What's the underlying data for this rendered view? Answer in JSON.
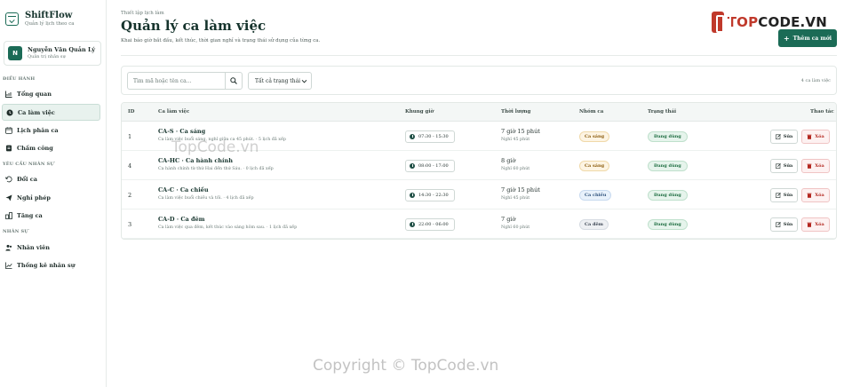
{
  "brand": {
    "name": "ShiftFlow",
    "subtitle": "Quản lý lịch theo ca"
  },
  "user": {
    "initial": "N",
    "name": "Nguyễn Văn Quản Lý",
    "role": "Quản trị nhân sự"
  },
  "sidebar": {
    "sections": [
      {
        "title": "Điều hành",
        "items": [
          {
            "label": "Tổng quan",
            "icon": "chart-icon"
          },
          {
            "label": "Ca làm việc",
            "icon": "clock-icon",
            "active": true
          },
          {
            "label": "Lịch phân ca",
            "icon": "calendar-icon"
          },
          {
            "label": "Chấm công",
            "icon": "fingerprint-icon"
          }
        ]
      },
      {
        "title": "Yêu cầu nhân sự",
        "items": [
          {
            "label": "Đổi ca",
            "icon": "swap-icon"
          },
          {
            "label": "Nghỉ phép",
            "icon": "send-icon"
          },
          {
            "label": "Tăng ca",
            "icon": "overtime-icon"
          }
        ]
      },
      {
        "title": "Nhân sự",
        "items": [
          {
            "label": "Nhân viên",
            "icon": "users-icon"
          },
          {
            "label": "Thống kê nhân sự",
            "icon": "stats-icon"
          }
        ]
      }
    ]
  },
  "header": {
    "breadcrumb": "Thiết lập lịch làm",
    "title": "Quản lý ca làm việc",
    "description": "Khai báo giờ bắt đầu, kết thúc, thời gian nghỉ và trạng thái sử dụng của từng ca.",
    "add_button": "Thêm ca mới"
  },
  "logo": {
    "prefix": "TOP",
    "suffix": "CODE.VN"
  },
  "filters": {
    "search_placeholder": "Tìm mã hoặc tên ca...",
    "status_selected": "Tất cả trạng thái",
    "count": "4 ca làm việc"
  },
  "table": {
    "columns": [
      "ID",
      "Ca làm việc",
      "Khung giờ",
      "Thời lượng",
      "Nhóm ca",
      "Trạng thái",
      "Thao tác"
    ],
    "rows": [
      {
        "id": "1",
        "name": "CA-S · Ca sáng",
        "desc": "Ca làm việc buổi sáng, nghỉ giữa ca 45 phút. · 5 lịch đã xếp",
        "time": "07:30 - 15:30",
        "duration": "7 giờ 15 phút",
        "break": "Nghỉ 45 phút",
        "group": "Ca sáng",
        "group_type": "sang",
        "status": "Đang dùng",
        "edit": "Sửa",
        "delete": "Xóa"
      },
      {
        "id": "4",
        "name": "CA-HC · Ca hành chính",
        "desc": "Ca hành chính từ thứ Hai đến thứ Sáu. · 0 lịch đã xếp",
        "time": "08:00 - 17:00",
        "duration": "8 giờ",
        "break": "Nghỉ 60 phút",
        "group": "Ca sáng",
        "group_type": "sang",
        "status": "Đang dùng",
        "edit": "Sửa",
        "delete": "Xóa"
      },
      {
        "id": "2",
        "name": "CA-C · Ca chiều",
        "desc": "Ca làm việc buổi chiều và tối. · 4 lịch đã xếp",
        "time": "14:30 - 22:30",
        "duration": "7 giờ 15 phút",
        "break": "Nghỉ 45 phút",
        "group": "Ca chiều",
        "group_type": "chieu",
        "status": "Đang dùng",
        "edit": "Sửa",
        "delete": "Xóa"
      },
      {
        "id": "3",
        "name": "CA-D · Ca đêm",
        "desc": "Ca làm việc qua đêm, kết thúc vào sáng hôm sau. · 1 lịch đã xếp",
        "time": "22:00 - 06:00",
        "duration": "7 giờ",
        "break": "Nghỉ 60 phút",
        "group": "Ca đêm",
        "group_type": "dem",
        "status": "Đang dùng",
        "edit": "Sửa",
        "delete": "Xóa"
      }
    ]
  },
  "watermarks": {
    "center": "TopCode.vn",
    "bottom": "Copyright © TopCode.vn"
  },
  "colors": {
    "primary": "#1b6b56",
    "danger": "#b3261e",
    "logo_red": "#c0392b"
  }
}
